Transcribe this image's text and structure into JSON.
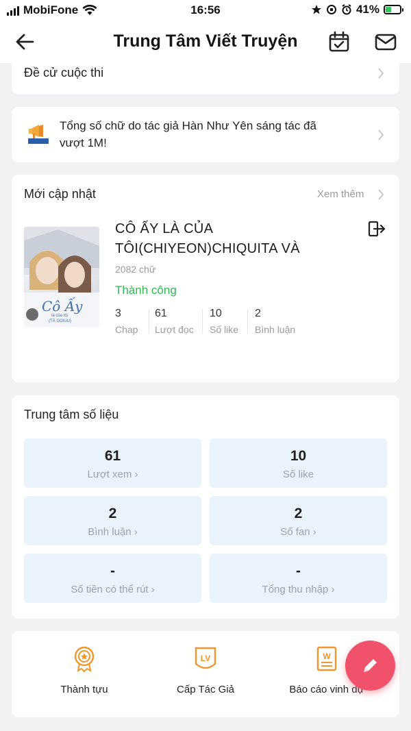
{
  "status_bar": {
    "carrier": "MobiFone",
    "time": "16:56",
    "battery": "41%",
    "battery_level": 0.41,
    "battery_color": "#34c759"
  },
  "header": {
    "title": "Trung Tâm Viết Truyện",
    "icons": [
      "back-arrow-icon",
      "calendar-check-icon",
      "mail-icon"
    ]
  },
  "contest_row": {
    "label": "Đề cử cuộc thi"
  },
  "announcement": {
    "text_line1": "Tổng số chữ do tác giả Hàn Như Yên sáng tác đã",
    "text_line2": "vượt 1M!",
    "icon": "megaphone-icon"
  },
  "updates": {
    "title": "Mới cập nhật",
    "more": "Xem thêm",
    "story": {
      "title_line1": "CÔ ẤY LÀ CỦA",
      "title_line2": "TÔI(CHIYEON)CHIQUITA VÀ",
      "words": "2082 chữ",
      "status": "Thành công",
      "status_color": "#2fb84f",
      "cover_title": "Cô Ấy",
      "cover_sub1": "là của tôi",
      "cover_sub2": "(TÁ GOIUU)",
      "stats": [
        {
          "value": "3",
          "label": "Chap"
        },
        {
          "value": "61",
          "label": "Lượt đọc"
        },
        {
          "value": "10",
          "label": "Số like"
        },
        {
          "value": "2",
          "label": "Bình luận"
        }
      ]
    }
  },
  "metrics": {
    "title": "Trung tâm số liệu",
    "tiles": [
      {
        "value": "61",
        "label": "Lượt xem"
      },
      {
        "value": "10",
        "label": "Số like"
      },
      {
        "value": "2",
        "label": "Bình luận"
      },
      {
        "value": "2",
        "label": "Số fan"
      },
      {
        "value": "-",
        "label": "Số tiền có thể rút"
      },
      {
        "value": "-",
        "label": "Tổng thu nhập"
      }
    ]
  },
  "bottom": {
    "items": [
      {
        "label": "Thành tựu",
        "icon": "medal-icon"
      },
      {
        "label": "Cấp Tác Giả",
        "icon": "level-badge-icon"
      },
      {
        "label": "Báo cáo vinh dự",
        "icon": "report-icon"
      }
    ],
    "accent": "#f0962a"
  },
  "fab": {
    "icon": "pencil-icon",
    "color": "#f0516b"
  }
}
